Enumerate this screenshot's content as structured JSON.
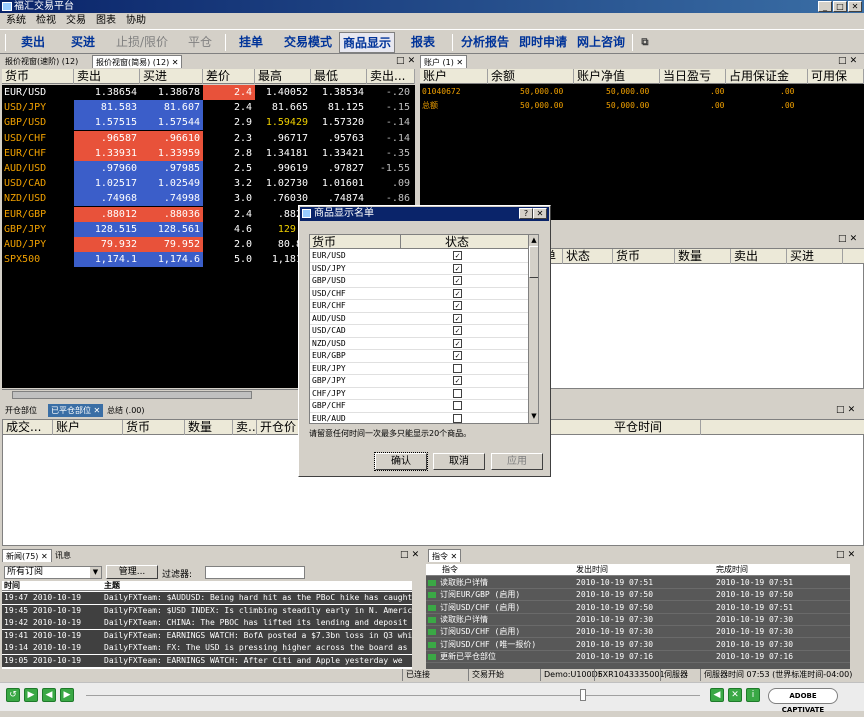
{
  "window": {
    "title": "福汇交易平台"
  },
  "menu": [
    "系统",
    "检视",
    "交易",
    "图表",
    "协助"
  ],
  "toolbar": {
    "sell": "卖出",
    "buy": "买进",
    "stop_limit": "止损/限价",
    "close": "平仓",
    "order": "挂单",
    "trade_mode": "交易模式",
    "product_display": "商品显示",
    "report": "报表",
    "analysis": "分析报告",
    "instant_apply": "即时申请",
    "online_consult": "网上咨询"
  },
  "quotes_panel": {
    "tab1": "报价视窗(速阶) (12)",
    "tab2": "报价视窗(简易) (12)",
    "columns": [
      "货币",
      "卖出",
      "买进",
      "差价",
      "最高",
      "最低",
      "卖出..."
    ],
    "rows": [
      {
        "sym": "EUR/USD",
        "sell": "1.38654",
        "buy": "1.38678",
        "spread": "2.4",
        "high": "1.40052",
        "low": "1.38534",
        "chg": "-.20",
        "sell_bg": "sel",
        "buy_bg": "sel",
        "high_color": "#ffffff"
      },
      {
        "sym": "USD/JPY",
        "sell": "81.583",
        "buy": "81.607",
        "spread": "2.4",
        "high": "81.665",
        "low": "81.125",
        "chg": "-.15",
        "sell_bg": "blue",
        "buy_bg": "blue",
        "high_color": "#ffffff"
      },
      {
        "sym": "GBP/USD",
        "sell": "1.57515",
        "buy": "1.57544",
        "spread": "2.9",
        "high": "1.59429",
        "low": "1.57320",
        "chg": "-.14",
        "sell_bg": "blue",
        "buy_bg": "blue",
        "high_color": "#f0d000"
      },
      {
        "sym": "USD/CHF",
        "sell": ".96587",
        "buy": ".96610",
        "spread": "2.3",
        "high": ".96717",
        "low": ".95763",
        "chg": "-.14",
        "sell_bg": "red",
        "buy_bg": "red",
        "high_color": "#ffffff"
      },
      {
        "sym": "EUR/CHF",
        "sell": "1.33931",
        "buy": "1.33959",
        "spread": "2.8",
        "high": "1.34181",
        "low": "1.33421",
        "chg": "-.35",
        "sell_bg": "red",
        "buy_bg": "red",
        "high_color": "#ffffff"
      },
      {
        "sym": "AUD/USD",
        "sell": ".97960",
        "buy": ".97985",
        "spread": "2.5",
        "high": ".99619",
        "low": ".97827",
        "chg": "-1.55",
        "sell_bg": "blue",
        "buy_bg": "blue",
        "high_color": "#ffffff"
      },
      {
        "sym": "USD/CAD",
        "sell": "1.02517",
        "buy": "1.02549",
        "spread": "3.2",
        "high": "1.02730",
        "low": "1.01601",
        "chg": ".09",
        "sell_bg": "blue",
        "buy_bg": "blue",
        "high_color": "#ffffff"
      },
      {
        "sym": "NZD/USD",
        "sell": ".74968",
        "buy": ".74998",
        "spread": "3.0",
        "high": ".76030",
        "low": ".74874",
        "chg": "-.86",
        "sell_bg": "blue",
        "buy_bg": "blue",
        "high_color": "#ffffff"
      },
      {
        "sym": "EUR/GBP",
        "sell": ".88012",
        "buy": ".88036",
        "spread": "2.4",
        "high": ".8826",
        "low": "",
        "chg": "",
        "sell_bg": "red",
        "buy_bg": "red",
        "high_color": "#ffffff"
      },
      {
        "sym": "GBP/JPY",
        "sell": "128.515",
        "buy": "128.561",
        "spread": "4.6",
        "high": "129.4",
        "low": "",
        "chg": "",
        "sell_bg": "blue",
        "buy_bg": "blue",
        "high_color": "#f0d000"
      },
      {
        "sym": "AUD/JPY",
        "sell": "79.932",
        "buy": "79.952",
        "spread": "2.0",
        "high": "80.89",
        "low": "",
        "chg": "",
        "sell_bg": "red",
        "buy_bg": "red",
        "high_color": "#ffffff"
      },
      {
        "sym": "SPX500",
        "sell": "1,174.1",
        "buy": "1,174.6",
        "spread": "5.0",
        "high": "1,181.",
        "low": "",
        "chg": "",
        "sell_bg": "blue",
        "buy_bg": "blue",
        "high_color": "#ffffff"
      }
    ]
  },
  "account_panel": {
    "tab": "账户 (1)",
    "columns": [
      "账户",
      "余额",
      "账户净值",
      "当日盈亏",
      "占用保证金",
      "可用保"
    ],
    "rows": [
      {
        "account": "01040672",
        "balance": "50,000.00",
        "equity": "50,000.00",
        "pl": ".00",
        "margin": ".00"
      },
      {
        "account": "总额",
        "balance": "50,000.00",
        "equity": "50,000.00",
        "pl": ".00",
        "margin": ".00"
      }
    ]
  },
  "orders_mid_panel": {
    "columns": [
      "单",
      "状态",
      "货币",
      "数量",
      "卖出",
      "买进"
    ]
  },
  "positions_panel": {
    "tabs": [
      "开仓部位",
      "已平仓部位",
      "总结 (.00)"
    ],
    "columns": [
      "成交...",
      "账户",
      "货币",
      "数量",
      "卖...",
      "开仓价",
      "平仓时间"
    ]
  },
  "dialog": {
    "title": "商品显示名单",
    "col_currency": "货币",
    "col_status": "状态",
    "items": [
      {
        "sym": "EUR/USD",
        "checked": true
      },
      {
        "sym": "USD/JPY",
        "checked": true
      },
      {
        "sym": "GBP/USD",
        "checked": true
      },
      {
        "sym": "USD/CHF",
        "checked": true
      },
      {
        "sym": "EUR/CHF",
        "checked": true
      },
      {
        "sym": "AUD/USD",
        "checked": true
      },
      {
        "sym": "USD/CAD",
        "checked": true
      },
      {
        "sym": "NZD/USD",
        "checked": true
      },
      {
        "sym": "EUR/GBP",
        "checked": true
      },
      {
        "sym": "EUR/JPY",
        "checked": false
      },
      {
        "sym": "GBP/JPY",
        "checked": true
      },
      {
        "sym": "CHF/JPY",
        "checked": false
      },
      {
        "sym": "GBP/CHF",
        "checked": false
      },
      {
        "sym": "EUR/AUD",
        "checked": false
      }
    ],
    "note": "请留意任何时间一次最多只能显示20个商品。",
    "ok": "确认",
    "cancel": "取消",
    "apply": "应用"
  },
  "news_panel": {
    "tabs": [
      "新闻(75)",
      "讯息"
    ],
    "filter_select": "所有订阅",
    "manage": "管理...",
    "filter_label": "过滤器:",
    "col_time": "时间",
    "col_subject": "主题",
    "rows": [
      {
        "time": "19:47 2010-10-19",
        "text": "DailyFXTeam: $AUDUSD: Being hard hit as the PBoC hike has caught"
      },
      {
        "time": "19:45 2010-10-19",
        "text": "DailyFXTeam: $USD INDEX: Is climbing steadily early in N. Americ"
      },
      {
        "time": "19:42 2010-10-19",
        "text": "DailyFXTeam: CHINA: The PBOC has lifted its lending and deposit"
      },
      {
        "time": "19:41 2010-10-19",
        "text": "DailyFXTeam: EARNINGS WATCH: BofA posted a $7.3bn loss in Q3 whi"
      },
      {
        "time": "19:14 2010-10-19",
        "text": "DailyFXTeam: FX: The USD is pressing higher across the board as"
      },
      {
        "time": "19:05 2010-10-19",
        "text": "DailyFXTeam: EARNINGS WATCH: After Citi and Apple yesterday we"
      }
    ]
  },
  "command_panel": {
    "tab": "指令",
    "columns": [
      "指令",
      "发出时间",
      "完成时间"
    ],
    "rows": [
      {
        "cmd": "读取账户详情",
        "sent": "2010-10-19 07:51",
        "done": "2010-10-19 07:51"
      },
      {
        "cmd": "订阅EUR/GBP (启用)",
        "sent": "2010-10-19 07:50",
        "done": "2010-10-19 07:50"
      },
      {
        "cmd": "订阅USD/CHF (启用)",
        "sent": "2010-10-19 07:50",
        "done": "2010-10-19 07:51"
      },
      {
        "cmd": "读取账户详情",
        "sent": "2010-10-19 07:30",
        "done": "2010-10-19 07:30"
      },
      {
        "cmd": "订阅USD/CHF (启用)",
        "sent": "2010-10-19 07:30",
        "done": "2010-10-19 07:30"
      },
      {
        "cmd": "订阅USD/CHF (唯一报价)",
        "sent": "2010-10-19 07:30",
        "done": "2010-10-19 07:30"
      },
      {
        "cmd": "更新已平仓部位",
        "sent": "2010-10-19 07:16",
        "done": "2010-10-19 07:16"
      }
    ]
  },
  "status_bar": {
    "connected": "已连接",
    "trading": "交易开始",
    "demo": "Demo:U100D5",
    "server": "FXR1043335001",
    "srv_label": "伺服器",
    "srv_time": "伺服器时间 07:53 (世界标准时间-04:00)"
  },
  "player": {
    "brand": "ADOBE CAPTIVATE"
  }
}
